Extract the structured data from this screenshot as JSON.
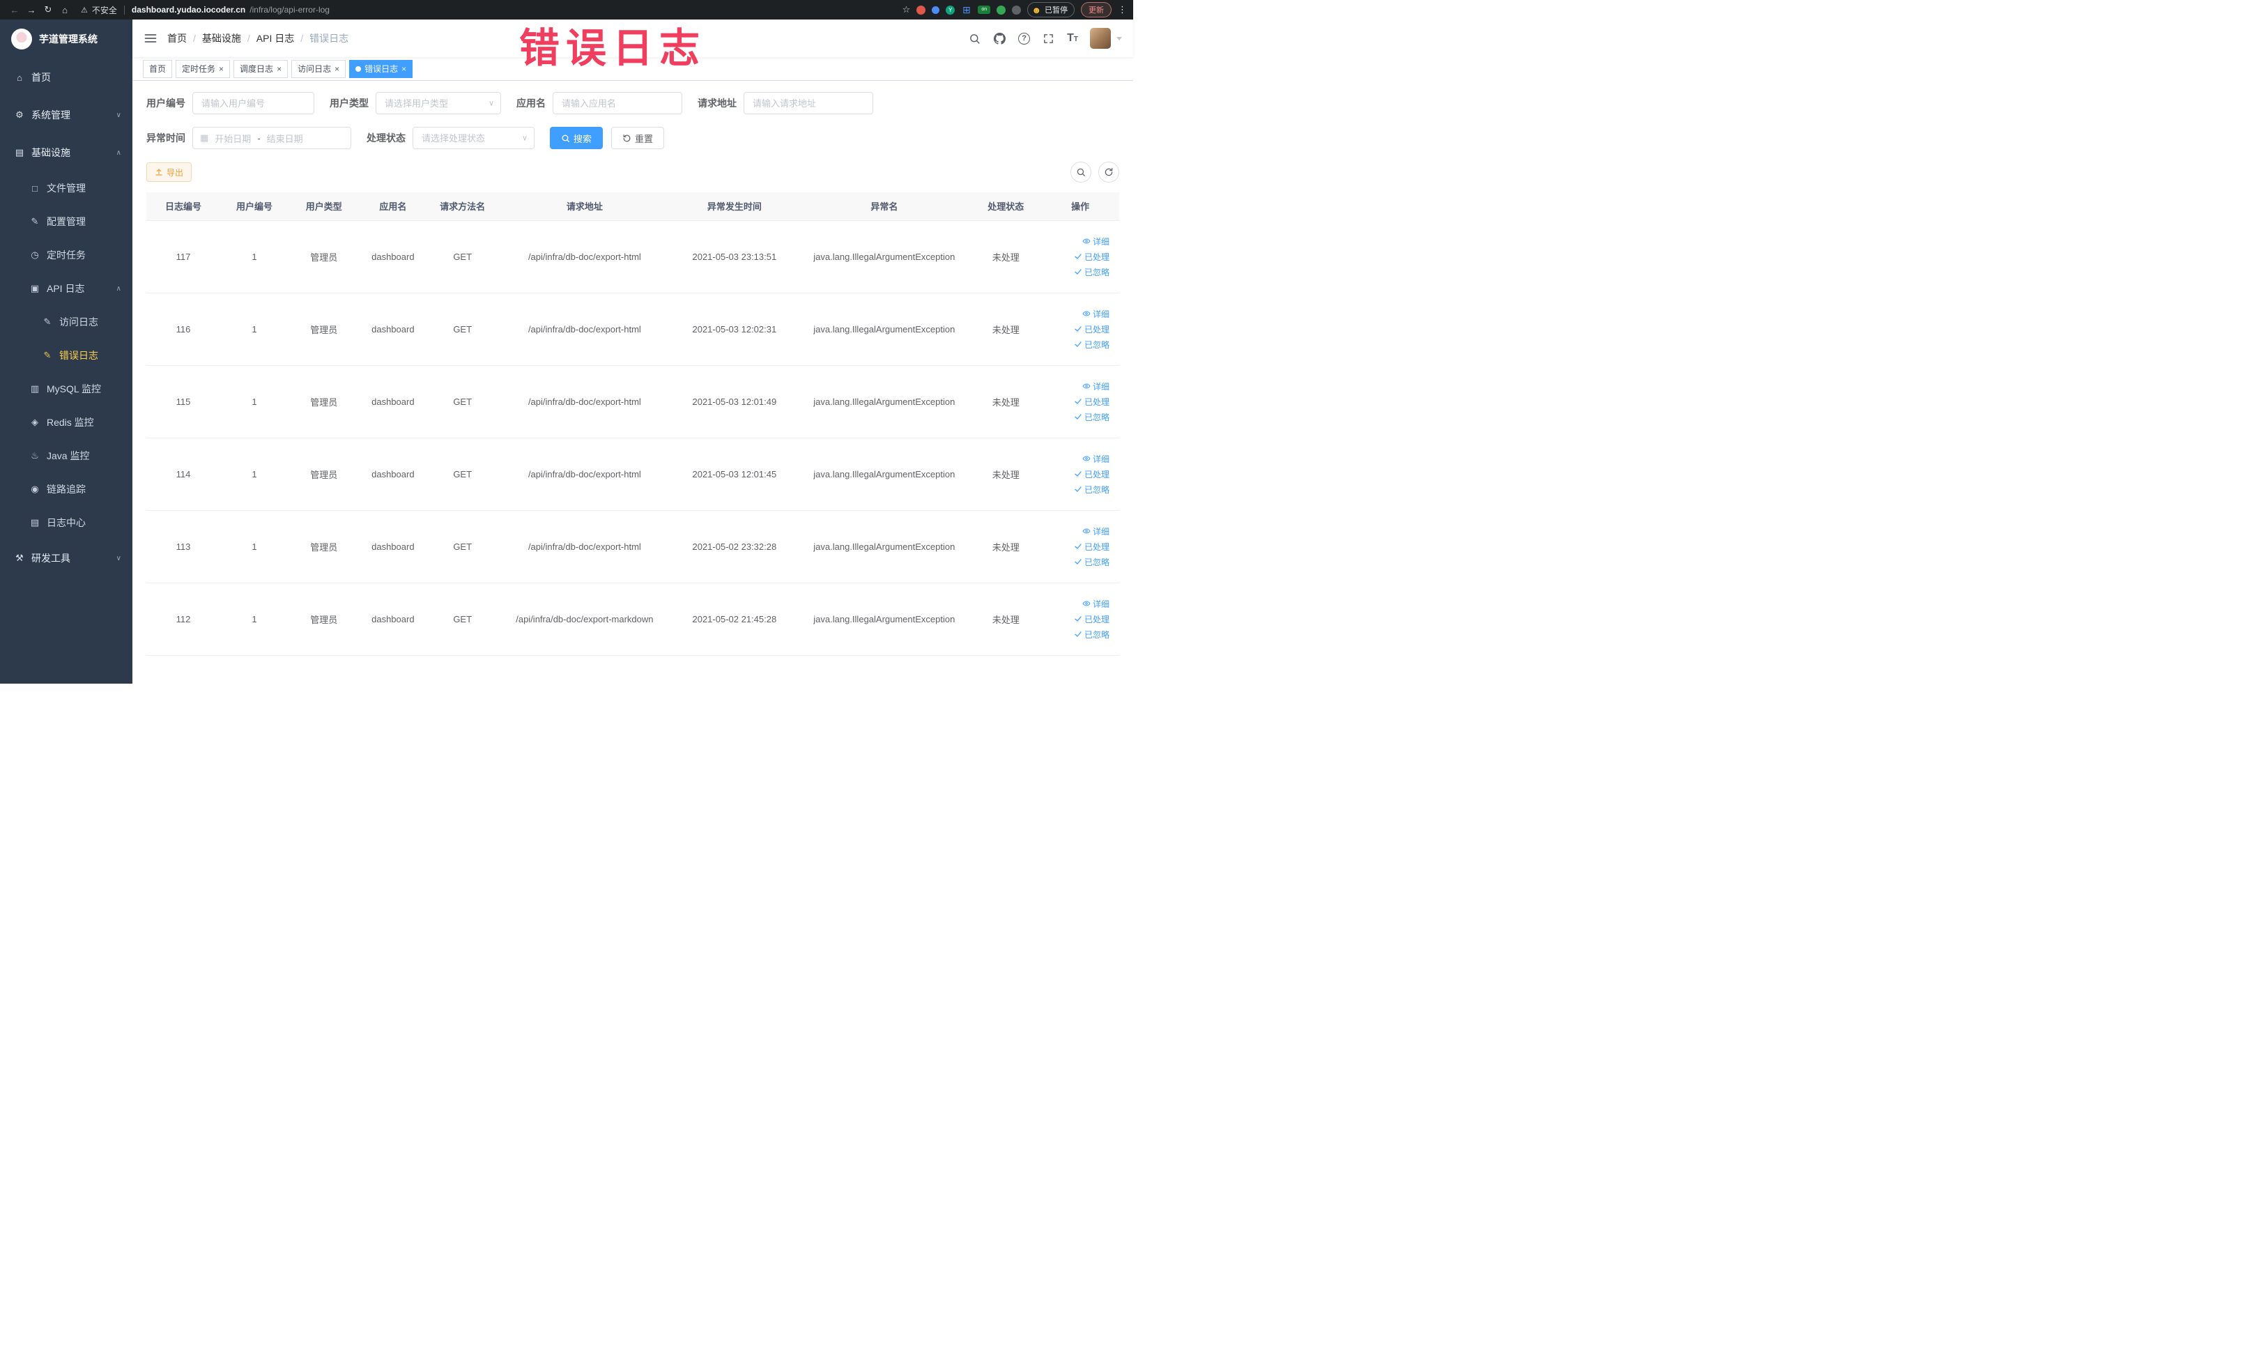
{
  "browser": {
    "security_text": "不安全",
    "url_host": "dashboard.yudao.iocoder.cn",
    "url_path": "/infra/log/api-error-log",
    "paused_label": "已暂停",
    "update_label": "更新",
    "nav_icons": [
      "back-icon",
      "forward-icon",
      "reload-icon",
      "browser-home-icon"
    ],
    "extension_icons": [
      "extension-icon",
      "extension-icon",
      "extension-icon",
      "extension-icon",
      "extension-icon",
      "extension-icon",
      "extension-icon"
    ]
  },
  "watermark": "错误日志",
  "sidebar": {
    "logo_title": "芋道管理系统",
    "items": [
      {
        "label": "首页",
        "icon": "home-icon",
        "cls": "lv1"
      },
      {
        "label": "系统管理",
        "icon": "gear-icon",
        "cls": "lv1",
        "chevron": "chevron-down-icon"
      },
      {
        "label": "基础设施",
        "icon": "infra-icon",
        "cls": "lv1 open",
        "chevron": "chevron-up-icon"
      },
      {
        "label": "文件管理",
        "icon": "file-icon",
        "cls": "lv2"
      },
      {
        "label": "配置管理",
        "icon": "config-icon",
        "cls": "lv2"
      },
      {
        "label": "定时任务",
        "icon": "job-icon",
        "cls": "lv2"
      },
      {
        "label": "API 日志",
        "icon": "api-log-icon",
        "cls": "lv2 open",
        "chevron": "chevron-up-icon"
      },
      {
        "label": "访问日志",
        "icon": "edit-icon",
        "cls": "lv3"
      },
      {
        "label": "错误日志",
        "icon": "edit-icon",
        "cls": "lv3 active"
      },
      {
        "label": "MySQL 监控",
        "icon": "mysql-icon",
        "cls": "lv2"
      },
      {
        "label": "Redis 监控",
        "icon": "redis-icon",
        "cls": "lv2"
      },
      {
        "label": "Java 监控",
        "icon": "java-icon",
        "cls": "lv2"
      },
      {
        "label": "链路追踪",
        "icon": "trace-icon",
        "cls": "lv2"
      },
      {
        "label": "日志中心",
        "icon": "log-center-icon",
        "cls": "lv2"
      },
      {
        "label": "研发工具",
        "icon": "tools-icon",
        "cls": "lv1",
        "chevron": "chevron-down-icon"
      }
    ]
  },
  "header": {
    "breadcrumb": [
      {
        "label": "首页",
        "cls": ""
      },
      {
        "label": "基础设施",
        "cls": ""
      },
      {
        "label": "API 日志",
        "cls": ""
      },
      {
        "label": "错误日志",
        "cls": "current"
      }
    ],
    "breadcrumb_separator": "/",
    "icons": [
      "search-icon",
      "github-icon",
      "question-icon",
      "fullscreen-icon",
      "font-size-icon",
      "user-avatar"
    ]
  },
  "tabs": [
    {
      "label": "首页",
      "cls": "",
      "active": false,
      "closable": false
    },
    {
      "label": "定时任务",
      "cls": "",
      "active": false,
      "closable": true
    },
    {
      "label": "调度日志",
      "cls": "",
      "active": false,
      "closable": true
    },
    {
      "label": "访问日志",
      "cls": "",
      "active": false,
      "closable": true
    },
    {
      "label": "错误日志",
      "cls": "active",
      "active": true,
      "closable": true
    }
  ],
  "filters": {
    "user_id": {
      "label": "用户编号",
      "placeholder": "请输入用户编号"
    },
    "user_type": {
      "label": "用户类型",
      "placeholder": "请选择用户类型"
    },
    "app_name": {
      "label": "应用名",
      "placeholder": "请输入应用名"
    },
    "request_url": {
      "label": "请求地址",
      "placeholder": "请输入请求地址"
    },
    "exception_time": {
      "label": "异常时间",
      "start_placeholder": "开始日期",
      "separator": "-",
      "end_placeholder": "结束日期"
    },
    "process_status": {
      "label": "处理状态",
      "placeholder": "请选择处理状态"
    },
    "search_label": "搜索",
    "reset_label": "重置"
  },
  "toolbar": {
    "export_label": "导出"
  },
  "table": {
    "columns": [
      "日志编号",
      "用户编号",
      "用户类型",
      "应用名",
      "请求方法名",
      "请求地址",
      "异常发生时间",
      "异常名",
      "处理状态",
      "操作"
    ],
    "rows": [
      {
        "id": "117",
        "user_id": "1",
        "user_type": "管理员",
        "app": "dashboard",
        "method": "GET",
        "url": "/api/infra/db-doc/export-html",
        "time": "2021-05-03 23:13:51",
        "exception": "java.lang.IllegalArgumentException",
        "status": "未处理"
      },
      {
        "id": "116",
        "user_id": "1",
        "user_type": "管理员",
        "app": "dashboard",
        "method": "GET",
        "url": "/api/infra/db-doc/export-html",
        "time": "2021-05-03 12:02:31",
        "exception": "java.lang.IllegalArgumentException",
        "status": "未处理"
      },
      {
        "id": "115",
        "user_id": "1",
        "user_type": "管理员",
        "app": "dashboard",
        "method": "GET",
        "url": "/api/infra/db-doc/export-html",
        "time": "2021-05-03 12:01:49",
        "exception": "java.lang.IllegalArgumentException",
        "status": "未处理"
      },
      {
        "id": "114",
        "user_id": "1",
        "user_type": "管理员",
        "app": "dashboard",
        "method": "GET",
        "url": "/api/infra/db-doc/export-html",
        "time": "2021-05-03 12:01:45",
        "exception": "java.lang.IllegalArgumentException",
        "status": "未处理"
      },
      {
        "id": "113",
        "user_id": "1",
        "user_type": "管理员",
        "app": "dashboard",
        "method": "GET",
        "url": "/api/infra/db-doc/export-html",
        "time": "2021-05-02 23:32:28",
        "exception": "java.lang.IllegalArgumentException",
        "status": "未处理"
      },
      {
        "id": "112",
        "user_id": "1",
        "user_type": "管理员",
        "app": "dashboard",
        "method": "GET",
        "url": "/api/infra/db-doc/export-markdown",
        "time": "2021-05-02 21:45:28",
        "exception": "java.lang.IllegalArgumentException",
        "status": "未处理"
      }
    ]
  },
  "row_actions": [
    {
      "icon": "eye-icon",
      "label": "详细"
    },
    {
      "icon": "check-icon",
      "label": "已处理"
    },
    {
      "icon": "check-icon",
      "label": "已忽略"
    }
  ]
}
